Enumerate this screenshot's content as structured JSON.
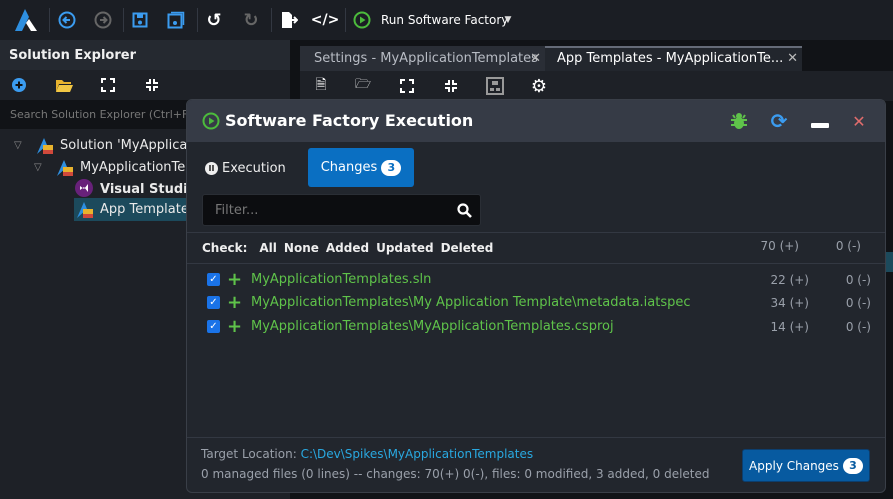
{
  "toolbar": {
    "run_label": "Run Software Factory",
    "icons": [
      "logo",
      "back-icon",
      "forward-icon",
      "save-icon",
      "save-all-icon",
      "undo-icon",
      "redo-icon",
      "export-icon",
      "code-icon",
      "run-icon",
      "caret-down-icon"
    ]
  },
  "solution_explorer": {
    "title": "Solution Explorer",
    "search_placeholder": "Search Solution Explorer (Ctrl+F)",
    "tree": [
      {
        "label": "Solution 'MyApplicationTemplates'"
      },
      {
        "label": "MyApplicationTemplates"
      },
      {
        "label": "Visual Studio"
      },
      {
        "label": "App Templates"
      }
    ]
  },
  "tabs": [
    {
      "label": "Settings - MyApplicationTemplates"
    },
    {
      "label": "App Templates - MyApplicationTe..."
    }
  ],
  "dialog": {
    "title": "Software Factory Execution",
    "tab_execution": "Execution",
    "tab_changes": "Changes",
    "changes_count": "3",
    "filter_placeholder": "Filter...",
    "check_label": "Check:",
    "check_options": [
      "All",
      "None",
      "Added",
      "Updated",
      "Deleted"
    ],
    "total_added": "70 (+)",
    "total_removed": "0 (-)",
    "files": [
      {
        "path": "MyApplicationTemplates.sln",
        "added": "22 (+)",
        "removed": "0 (-)"
      },
      {
        "path": "MyApplicationTemplates\\My Application Template\\metadata.iatspec",
        "added": "34 (+)",
        "removed": "0 (-)"
      },
      {
        "path": "MyApplicationTemplates\\MyApplicationTemplates.csproj",
        "added": "14 (+)",
        "removed": "0 (-)"
      }
    ],
    "target_label": "Target Location:",
    "target_path": "C:\\Dev\\Spikes\\MyApplicationTemplates",
    "summary": "0 managed files (0 lines) -- changes: 70(+) 0(-), files: 0 modified, 3 added, 0 deleted",
    "apply_label": "Apply Changes",
    "apply_count": "3"
  },
  "colors": {
    "accent": "#0a6fc2",
    "added": "#5fc34a",
    "link": "#29a8e0"
  }
}
